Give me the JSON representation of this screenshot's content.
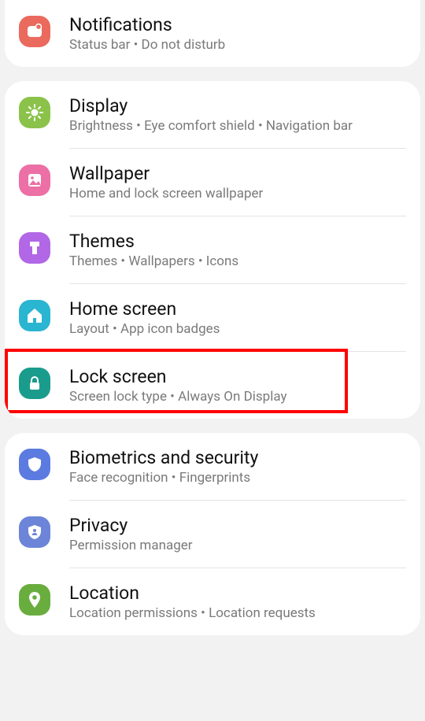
{
  "groups": [
    {
      "items": [
        {
          "key": "notifications",
          "title": "Notifications",
          "sub": "Status bar  •  Do not disturb",
          "color": "#ea6a5d",
          "icon": "notification"
        }
      ]
    },
    {
      "items": [
        {
          "key": "display",
          "title": "Display",
          "sub": "Brightness  •  Eye comfort shield  •  Navigation bar",
          "color": "#8bc34a",
          "icon": "brightness"
        },
        {
          "key": "wallpaper",
          "title": "Wallpaper",
          "sub": "Home and lock screen wallpaper",
          "color": "#ec6fa5",
          "icon": "wallpaper"
        },
        {
          "key": "themes",
          "title": "Themes",
          "sub": "Themes  •  Wallpapers  •  Icons",
          "color": "#b167e6",
          "icon": "themes"
        },
        {
          "key": "home-screen",
          "title": "Home screen",
          "sub": "Layout  •  App icon badges",
          "color": "#2ab5d1",
          "icon": "home"
        },
        {
          "key": "lock-screen",
          "title": "Lock screen",
          "sub": "Screen lock type  •  Always On Display",
          "color": "#1a9c8c",
          "icon": "lock",
          "highlight": true
        }
      ]
    },
    {
      "items": [
        {
          "key": "biometrics",
          "title": "Biometrics and security",
          "sub": "Face recognition  •  Fingerprints",
          "color": "#5c7be0",
          "icon": "shield"
        },
        {
          "key": "privacy",
          "title": "Privacy",
          "sub": "Permission manager",
          "color": "#6c85d8",
          "icon": "privacy"
        },
        {
          "key": "location",
          "title": "Location",
          "sub": "Location permissions  •  Location requests",
          "color": "#6aad3f",
          "icon": "location"
        }
      ]
    }
  ]
}
